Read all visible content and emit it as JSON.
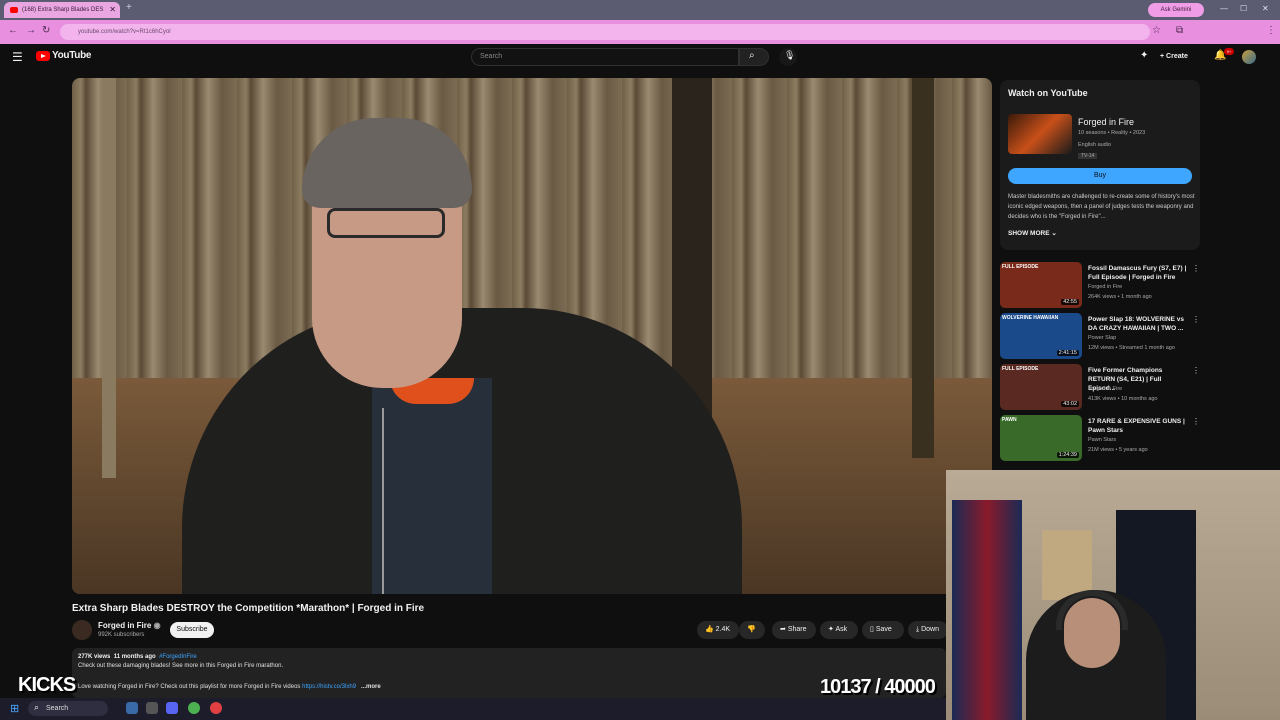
{
  "browser": {
    "tab_title": "(168) Extra Sharp Blades DES",
    "tab_close": "✕",
    "new_tab": "+",
    "ask_gemini": "Ask Gemini",
    "url": "youtube.com/watch?v=Rt1c6hCyol",
    "minimize": "—",
    "maximize": "☐",
    "close": "✕"
  },
  "youtube": {
    "logo_text": "YouTube",
    "search_placeholder": "Search",
    "create_label": "Create",
    "notif_count": "9+"
  },
  "video": {
    "title": "Extra Sharp Blades DESTROY the Competition *Marathon* | Forged in Fire",
    "channel": "Forged in Fire",
    "subscribers": "992K subscribers",
    "subscribe_label": "Subscribe",
    "likes": "2.4K",
    "share_label": "Share",
    "ask_label": "Ask",
    "save_label": "Save",
    "download_label": "Down",
    "views": "277K views",
    "age": "11 months ago",
    "hashtag": "#ForgedInFire",
    "desc_line1": "Check out these damaging blades! See more in this Forged in Fire marathon.",
    "desc_line2": "Love watching Forged in Fire? Check out this playlist for more Forged in Fire videos",
    "desc_link": "https://histv.co/3lxh9",
    "more_label": "...more"
  },
  "overlay": {
    "kicks": "KICKS",
    "counter": "10137 / 40000"
  },
  "watch_card": {
    "heading": "Watch on YouTube",
    "show_title": "Forged in Fire",
    "show_meta": "10 seasons • Reality • 2023",
    "audio": "English audio",
    "rating": "TV-14",
    "buy_label": "Buy",
    "synopsis": "Master bladesmiths are challenged to re-create some of history's most iconic edged weapons, then a panel of judges tests the weaponry and decides who is the \"Forged in Fire\"...",
    "show_more": "SHOW MORE"
  },
  "recommendations": [
    {
      "title": "Fossil Damascus Fury (S7, E7) | Full Episode | Forged in Fire",
      "channel": "Forged in Fire",
      "meta": "264K views • 1 month ago",
      "duration": "42:55",
      "badge": "FULL EPISODE",
      "thumb_color": "#7a2a1a"
    },
    {
      "title": "Power Slap 18: WOLVERINE vs DA CRAZY HAWAIIAN | TWO ...",
      "channel": "Power Slap",
      "meta": "12M views • Streamed 1 month ago",
      "duration": "2:41:15",
      "badge": "WOLVERINE HAWAIIAN",
      "thumb_color": "#1a4a8a"
    },
    {
      "title": "Five Former Champions RETURN (S4, E21) | Full Episod...",
      "channel": "Forged in Fire",
      "meta": "413K views • 10 months ago",
      "duration": "43:02",
      "badge": "FULL EPISODE",
      "thumb_color": "#5a2a22"
    },
    {
      "title": "17 RARE & EXPENSIVE GUNS | Pawn Stars",
      "channel": "Pawn Stars",
      "meta": "21M views • 5 years ago",
      "duration": "1:24:39",
      "badge": "PAWN",
      "thumb_color": "#3a6a2a"
    }
  ],
  "taskbar": {
    "search": "Search"
  }
}
